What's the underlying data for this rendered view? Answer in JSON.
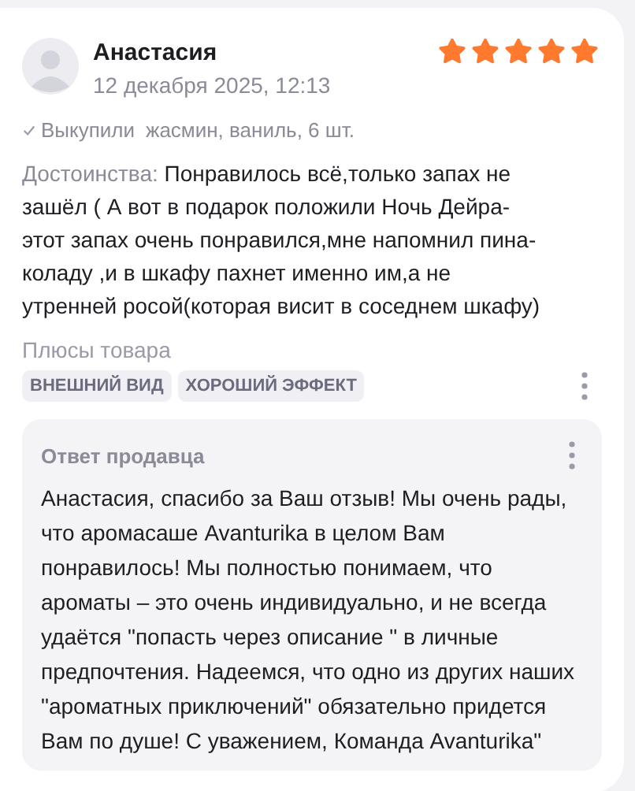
{
  "review": {
    "author": "Анастасия",
    "date": "12 декабря 2025, 12:13",
    "stars": 5,
    "purchase": {
      "label": "Выкупили",
      "details": "жасмин, ваниль, 6 шт."
    },
    "advantages": {
      "label": "Достоинства:",
      "text": "Понравилось всё,только запах не зашёл ( А вот в подарок положили Ночь Дейра-этот запах очень понравился,мне напомнил пина-коладу ,и в шкафу пахнет именно им,а не утренней росой(которая висит в соседнем шкафу)"
    },
    "pros_title": "Плюсы товара",
    "tags": [
      "ВНЕШНИЙ ВИД",
      "ХОРОШИЙ ЭФФЕКТ"
    ],
    "seller_reply": {
      "title": "Ответ продавца",
      "text": "Анастасия, спасибо за Ваш отзыв! Мы очень рады, что аромасаше Avanturika в целом Вам понравилось! Мы полностью понимаем, что ароматы – это очень индивидуально, и не всегда удаётся \"попасть через описание \" в личные предпочтения. Надеемся, что одно из других наших \"ароматных приключений\" обязательно придется Вам по душе! С уважением, Команда Avanturika\""
    }
  }
}
